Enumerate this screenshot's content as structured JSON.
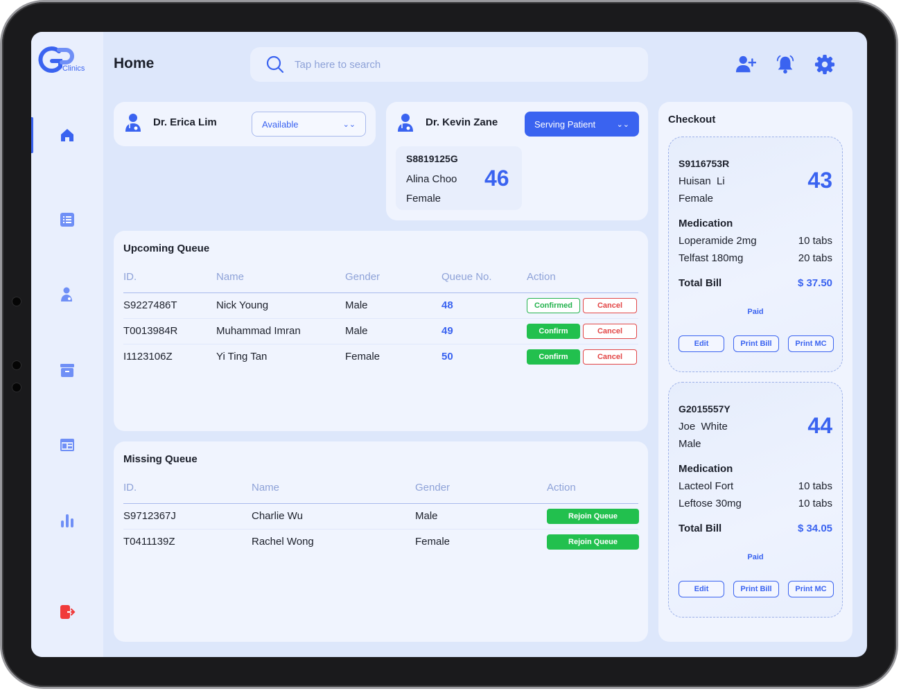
{
  "app": {
    "logo_text": "Clinics",
    "page_title": "Home"
  },
  "colors": {
    "accent": "#3a63f0",
    "success": "#22c04e",
    "danger": "#e24545",
    "logout": "#f03a3a"
  },
  "sidebar": {
    "items": [
      {
        "icon": "home-icon",
        "active": true
      },
      {
        "icon": "list-icon",
        "active": false
      },
      {
        "icon": "doctor-icon",
        "active": false
      },
      {
        "icon": "archive-icon",
        "active": false
      },
      {
        "icon": "calendar-icon",
        "active": false
      },
      {
        "icon": "bar-chart-icon",
        "active": false
      },
      {
        "icon": "logout-icon",
        "active": false
      }
    ]
  },
  "search": {
    "placeholder": "Tap here to search",
    "value": ""
  },
  "header_icons": [
    "add-user-icon",
    "notification-bell-icon",
    "settings-gear-icon"
  ],
  "doctors": [
    {
      "name": "Dr. Erica Lim",
      "status": "Available"
    },
    {
      "name": "Dr. Kevin Zane",
      "status": "Serving Patient",
      "serving": {
        "id": "S8819125G",
        "name": "Alina Choo",
        "gender": "Female",
        "queue_no": "46"
      }
    }
  ],
  "upcoming_queue": {
    "title": "Upcoming Queue",
    "headers": [
      "ID.",
      "Name",
      "Gender",
      "Queue No.",
      "Action"
    ],
    "rows": [
      {
        "id": "S9227486T",
        "name": "Nick Young",
        "gender": "Male",
        "queue_no": "48",
        "primary_action": "Confirmed",
        "secondary_action": "Cancel"
      },
      {
        "id": "T0013984R",
        "name": "Muhammad Imran",
        "gender": "Male",
        "queue_no": "49",
        "primary_action": "Confirm",
        "secondary_action": "Cancel"
      },
      {
        "id": "I1123106Z",
        "name": "Yi Ting Tan",
        "gender": "Female",
        "queue_no": "50",
        "primary_action": "Confirm",
        "secondary_action": "Cancel"
      }
    ]
  },
  "missing_queue": {
    "title": "Missing Queue",
    "headers": [
      "ID.",
      "Name",
      "Gender",
      "Action"
    ],
    "rows": [
      {
        "id": "S9712367J",
        "name": "Charlie Wu",
        "gender": "Male",
        "action": "Rejoin Queue"
      },
      {
        "id": "T0411139Z",
        "name": "Rachel Wong",
        "gender": "Female",
        "action": "Rejoin Queue"
      }
    ]
  },
  "checkout": {
    "title": "Checkout",
    "patients": [
      {
        "id": "S9116753R",
        "name": "Huisan  Li",
        "gender": "Female",
        "queue_no": "43",
        "medication_title": "Medication",
        "medications": [
          {
            "name": "Loperamide 2mg",
            "qty": "10 tabs"
          },
          {
            "name": "Telfast 180mg",
            "qty": "20 tabs"
          }
        ],
        "total_label": "Total Bill",
        "total": "$ 37.50",
        "status": "Paid",
        "buttons": {
          "edit": "Edit",
          "print_bill": "Print Bill",
          "print_mc": "Print MC"
        }
      },
      {
        "id": "G2015557Y",
        "name": "Joe  White",
        "gender": "Male",
        "queue_no": "44",
        "medication_title": "Medication",
        "medications": [
          {
            "name": "Lacteol Fort",
            "qty": "10 tabs"
          },
          {
            "name": "Leftose 30mg",
            "qty": "10 tabs"
          }
        ],
        "total_label": "Total Bill",
        "total": "$ 34.05",
        "status": "Paid",
        "buttons": {
          "edit": "Edit",
          "print_bill": "Print Bill",
          "print_mc": "Print MC"
        }
      }
    ]
  }
}
